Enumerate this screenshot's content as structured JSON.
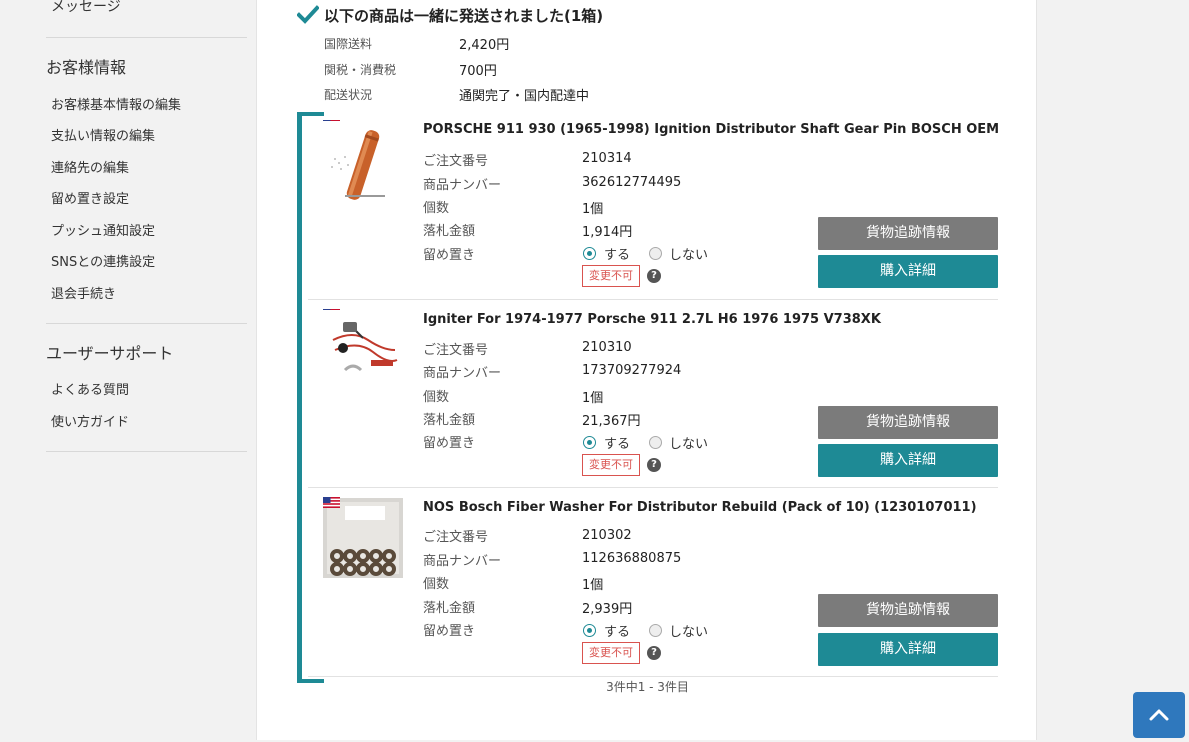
{
  "sidebar": {
    "message_link": "メッセージ",
    "customer_heading": "お客様情報",
    "customer_links": [
      "お客様基本情報の編集",
      "支払い情報の編集",
      "連絡先の編集",
      "留め置き設定",
      "プッシュ通知設定",
      "SNSとの連携設定",
      "退会手続き"
    ],
    "support_heading": "ユーザーサポート",
    "support_links": [
      "よくある質問",
      "使い方ガイド"
    ]
  },
  "shipment": {
    "title": "以下の商品は一緒に発送されました(1箱)",
    "summary": [
      {
        "label": "国際送料",
        "value": "2,420円"
      },
      {
        "label": "関税・消費税",
        "value": "700円"
      },
      {
        "label": "配送状況",
        "value": "通関完了・国内配達中"
      }
    ]
  },
  "labels": {
    "order_no": "ご注文番号",
    "item_no": "商品ナンバー",
    "qty": "個数",
    "price": "落札金額",
    "hold": "留め置き",
    "hold_yes": "する",
    "hold_no": "しない",
    "locked": "変更不可",
    "help": "?",
    "track_button": "貨物追跡情報",
    "detail_button": "購入詳細"
  },
  "items": [
    {
      "title": "PORSCHE 911 930 (1965-1998) Ignition Distributor Shaft Gear Pin BOSCH OEM",
      "order_no": "210314",
      "item_no": "362612774495",
      "qty": "1個",
      "price": "1,914円",
      "hold": true,
      "thumb": "copper-pin"
    },
    {
      "title": "Igniter For 1974-1977 Porsche 911 2.7L H6 1976 1975 V738XK",
      "order_no": "210310",
      "item_no": "173709277924",
      "qty": "1個",
      "price": "21,367円",
      "hold": true,
      "thumb": "wiring"
    },
    {
      "title": "NOS Bosch Fiber Washer For Distributor Rebuild (Pack of 10) (1230107011)",
      "order_no": "210302",
      "item_no": "112636880875",
      "qty": "1個",
      "price": "2,939円",
      "hold": true,
      "thumb": "washers"
    }
  ],
  "pagination": "3件中1 - 3件目",
  "colors": {
    "accent": "#1e8a95",
    "track_button": "#7b7b7b",
    "top_button": "#2f78bd",
    "badge": "#d9534f"
  },
  "icons": {
    "check": "check-icon",
    "flag": "us-flag-icon",
    "help": "question-icon",
    "scroll_top": "chevron-up-icon"
  }
}
